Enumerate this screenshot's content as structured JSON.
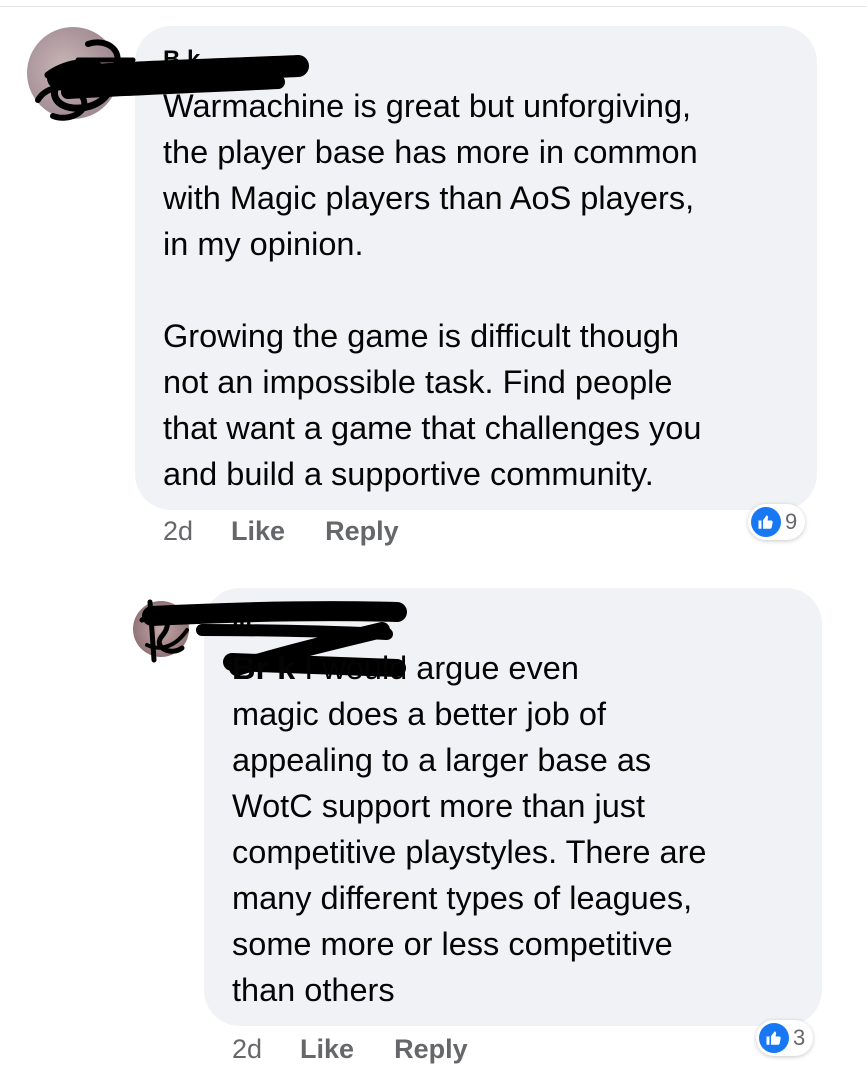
{
  "comments": [
    {
      "author": "B           k",
      "text": "Warmachine is great but unforgiving,\nthe player base has more in common\nwith Magic players than AoS players,\nin my opinion.\n\nGrowing the game is difficult though\nnot an impossible task. Find people\nthat want a game that challenges you\nand build a supportive community.",
      "time": "2d",
      "like_label": "Like",
      "reply_label": "Reply",
      "reactions": "9"
    },
    {
      "author": "              ill",
      "mention": "Br          k",
      "text": " I would argue even\nmagic does a better job of\nappealing to a larger base as\nWotC support more than just\ncompetitive playstyles.  There are\nmany different types of leagues,\nsome more or less competitive\nthan others",
      "time": "2d",
      "like_label": "Like",
      "reply_label": "Reply",
      "reactions": "3"
    }
  ],
  "colors": {
    "bubble": "#f0f2f5",
    "meta_text": "#65676b",
    "like_blue": "#1877f2",
    "redaction": "#000000"
  }
}
